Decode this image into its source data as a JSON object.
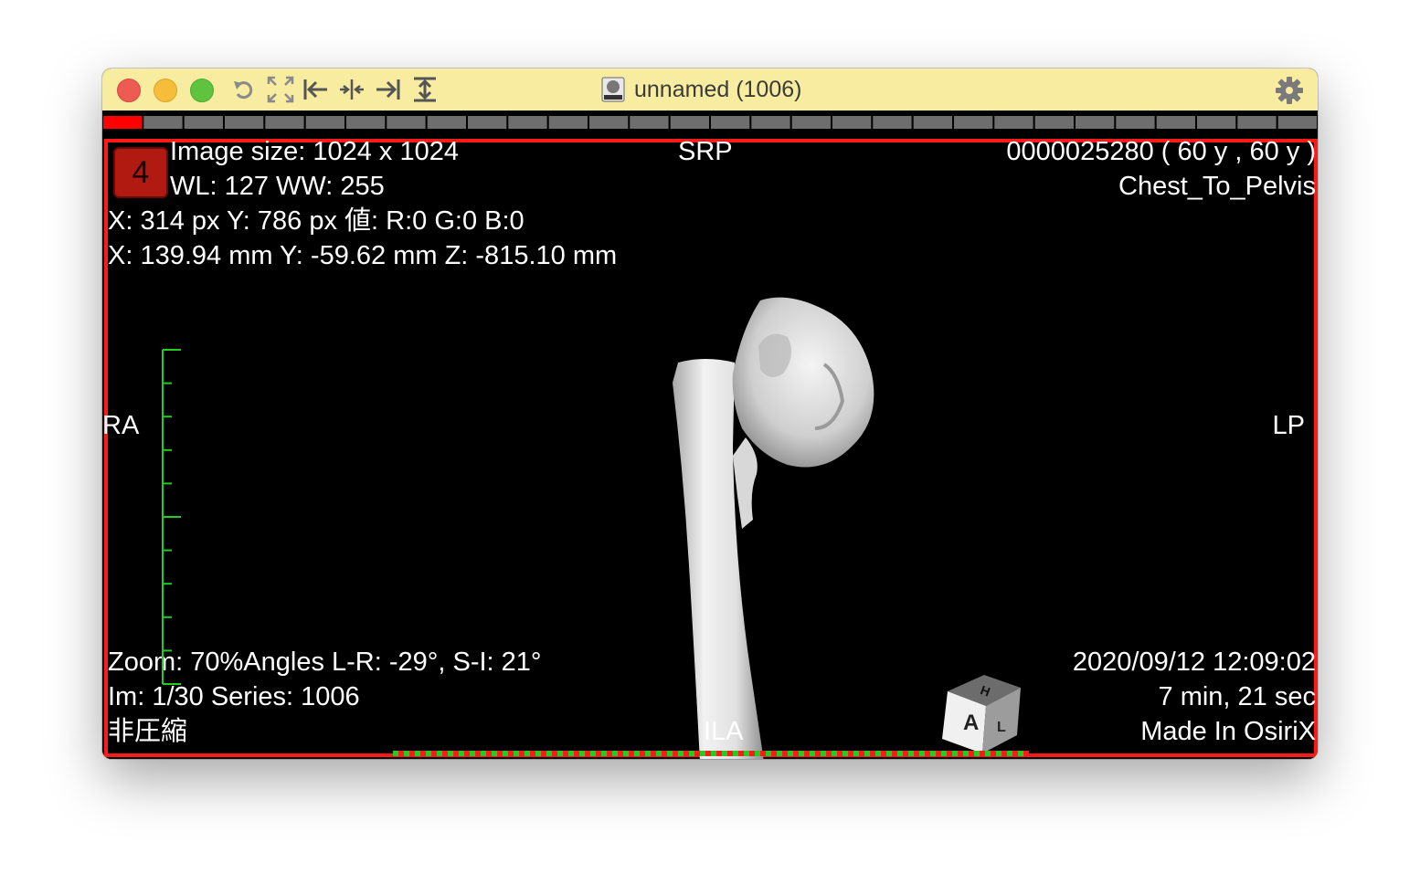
{
  "window": {
    "title": "unnamed (1006)",
    "title_icon": "dicom-file-icon",
    "toolbar_icons": [
      "rotate-icon",
      "fullscreen-icon",
      "first-frame-icon",
      "center-icon",
      "last-frame-icon",
      "stack-icon"
    ],
    "settings_icon": "gear-icon"
  },
  "slice_bar": {
    "count": 30,
    "current": 1
  },
  "overlay": {
    "series_badge": "4",
    "top_left": {
      "image_size": "Image size: 1024 x 1024",
      "window_level": "WL: 127 WW: 255",
      "pixel_pos": "X: 314 px Y: 786 px 値: R:0 G:0 B:0",
      "mm_pos": "X: 139.94 mm Y: -59.62 mm Z: -815.10 mm"
    },
    "top_center": "SRP",
    "top_right": {
      "patient_id": "0000025280 (  60 y ,  60 y )",
      "study": "Chest_To_Pelvis"
    },
    "left": "RA",
    "right": "LP",
    "bottom_left": {
      "zoom_angles": "Zoom: 70%Angles L-R: -29°, S-I: 21°",
      "image_series": "Im: 1/30  Series:  1006",
      "compression": "非圧縮"
    },
    "bottom_center": "ILA",
    "bottom_right": {
      "datetime": "2020/09/12 12:09:02",
      "duration": "7 min, 21 sec",
      "made_in": "Made In OsiriX"
    },
    "orientation_cube": {
      "front": "A",
      "top": "H",
      "side": "L"
    }
  },
  "colors": {
    "titlebar": "#f7eca0",
    "frame": "#ff1a1a",
    "ruler": "#22cc22",
    "slice_active": "#ff0000"
  }
}
